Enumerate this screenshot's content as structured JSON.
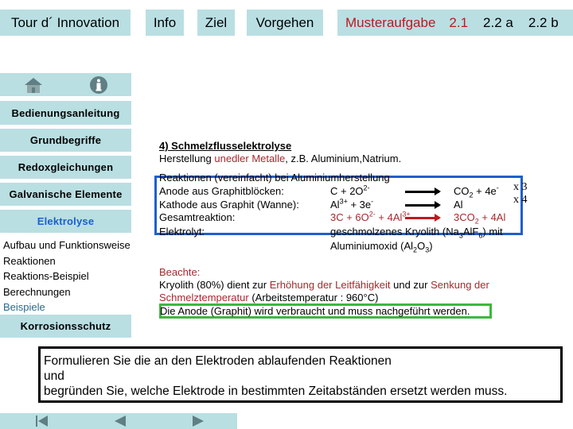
{
  "topnav": {
    "tour": "Tour d´ Innovation",
    "info": "Info",
    "ziel": "Ziel",
    "vorgehen": "Vorgehen",
    "musteraufgabe": "Musteraufgabe",
    "t21": "2.1",
    "t22a": "2.2 a",
    "t22b": "2.2 b"
  },
  "sidebar": {
    "icons": {
      "home": "home-icon",
      "info": "info-icon"
    },
    "bedienungsanleitung": "Bedienungsanleitung",
    "items": [
      {
        "label": "Grundbegriffe",
        "active": false
      },
      {
        "label": "Redoxgleichungen",
        "active": false
      },
      {
        "label": "Galvanische Elemente",
        "active": false
      },
      {
        "label": "Elektrolyse",
        "active": true
      }
    ],
    "subitems": [
      {
        "label": "Aufbau und Funktionsweise"
      },
      {
        "label": "Reaktionen"
      },
      {
        "label": "Reaktions-Beispiel"
      },
      {
        "label": "Berechnungen"
      },
      {
        "label": "Beispiele"
      }
    ],
    "korrosionsschutz": "Korrosionsschutz"
  },
  "content": {
    "heading": "4) Schmelzflusselektrolyse",
    "intro_prefix": "Herstellung ",
    "intro_highlight": "unedler Metalle",
    "intro_suffix": ", z.B. Aluminium,Natrium.",
    "reactions_title": "Reaktionen (vereinfacht) bei Aluminiumherstellung",
    "rows": {
      "anode_label": "Anode aus Graphitblöcken:",
      "anode_left_a": "C + 2O",
      "anode_left_sup": "2-",
      "anode_right_a": "CO",
      "anode_right_sub": "2",
      "anode_right_b": " + 4e",
      "anode_right_sup": "-",
      "anode_mult": "x 3",
      "kathode_label": "Kathode aus Graphit (Wanne):",
      "kathode_left_a": "Al",
      "kathode_left_sup": "3+",
      "kathode_left_b": " + 3e",
      "kathode_left_sup2": "-",
      "kathode_right": "Al",
      "kathode_mult": "x 4",
      "gesamt_label": "Gesamtreaktion:",
      "gesamt_left_a": "3C + 6O",
      "gesamt_left_sup": "2-",
      "gesamt_left_b": " + 4Al",
      "gesamt_left_sup2": "3+",
      "gesamt_right_a": "3CO",
      "gesamt_right_sub": "2",
      "gesamt_right_b": " + 4Al",
      "elektrolyt_label": "Elektrolyt:",
      "elektrolyt_a": "geschmolzenes Kryolith (Na",
      "elektrolyt_sub1": "3",
      "elektrolyt_b": "AlF",
      "elektrolyt_sub2": "6",
      "elektrolyt_c": ") mit",
      "elektrolyt2_a": "Aluminiumoxid (Al",
      "elektrolyt2_sub1": "2",
      "elektrolyt2_b": "O",
      "elektrolyt2_sub2": "3",
      "elektrolyt2_c": ")"
    },
    "beachte": "Beachte:",
    "note1_a": "Kryolith (80%) dient zur ",
    "note1_red1": "Erhöhung der Leitfähigkeit",
    "note1_b": " und zur ",
    "note1_red2": "Senkung der",
    "note2_red": "Schmelztemperatur",
    "note2_b": " (Arbeitstemperatur : 960°C)",
    "note3": "Die Anode (Graphit) wird verbraucht und muss nachgeführt werden."
  },
  "task": {
    "line1": "Formulieren Sie die an den Elektroden ablaufenden Reaktionen",
    "line2": "und",
    "line3": "begründen Sie, welche Elektrode in bestimmten Zeitabständen ersetzt werden muss."
  },
  "bottomnav": {
    "first": "first-page-icon",
    "prev": "previous-page-icon",
    "next": "next-page-icon"
  },
  "colors": {
    "tab_bg": "#b9dfe3",
    "accent_red": "#c0181e",
    "accent_blue": "#1a5fd0",
    "box_blue": "#1f5fcc",
    "box_green": "#3cb83c",
    "icon_gray": "#5f7f84"
  }
}
